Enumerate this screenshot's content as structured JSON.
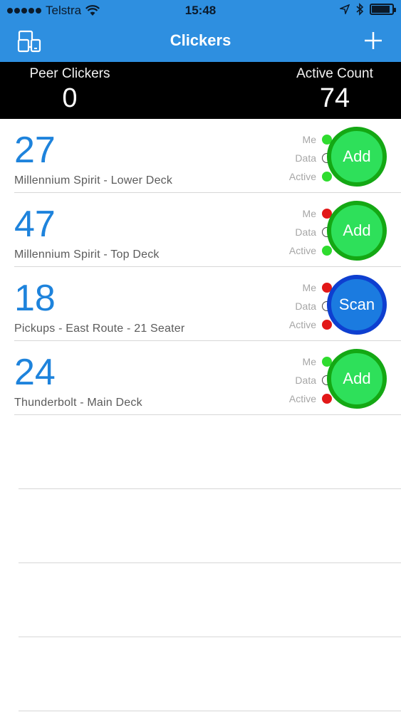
{
  "status_bar": {
    "carrier": "Telstra",
    "time": "15:48",
    "battery_level": 0.9
  },
  "nav": {
    "title": "Clickers",
    "left_icon": "devices-icon",
    "right_icon": "plus-icon"
  },
  "counts": {
    "peer_label": "Peer Clickers",
    "peer_value": "0",
    "active_label": "Active Count",
    "active_value": "74"
  },
  "indicator_labels": {
    "me": "Me",
    "data": "Data",
    "active": "Active"
  },
  "colors": {
    "accent": "#2e8fe0",
    "count_blue": "#1e83dc",
    "green": "#2fdc2f",
    "red": "#e21818",
    "add_button": "#2ee05a",
    "scan_button": "#1b7be0"
  },
  "clickers": [
    {
      "count": "27",
      "name": "Millennium Spirit - Lower Deck",
      "me": "green",
      "data": "empty",
      "active": "green",
      "action": "Add",
      "action_type": "add"
    },
    {
      "count": "47",
      "name": "Millennium Spirit - Top Deck",
      "me": "red",
      "data": "empty",
      "active": "green",
      "action": "Add",
      "action_type": "add"
    },
    {
      "count": "18",
      "name": "Pickups - East Route - 21 Seater",
      "me": "red",
      "data": "empty",
      "active": "red",
      "action": "Scan",
      "action_type": "scan"
    },
    {
      "count": "24",
      "name": "Thunderbolt - Main Deck",
      "me": "green",
      "data": "empty",
      "active": "red",
      "action": "Add",
      "action_type": "add"
    }
  ]
}
